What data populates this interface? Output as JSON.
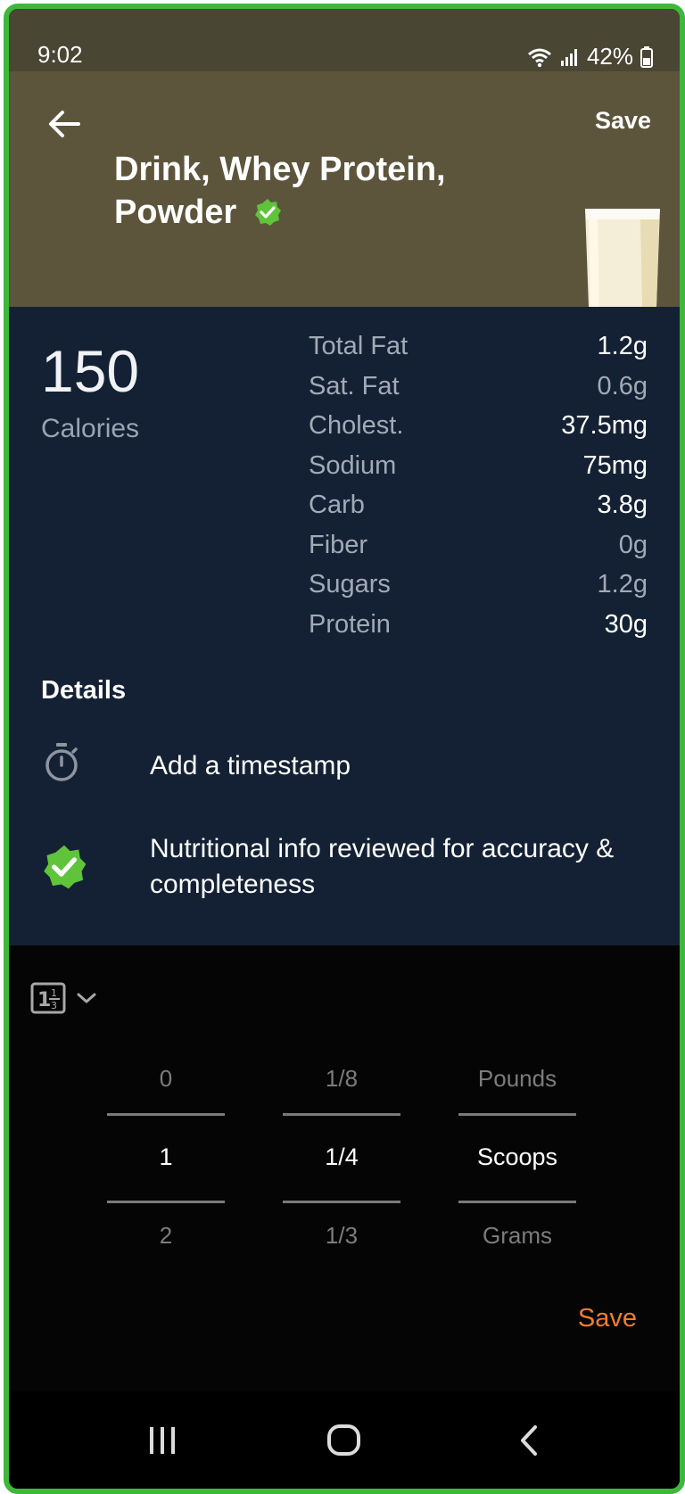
{
  "status_bar": {
    "time": "9:02",
    "battery": "42%",
    "wifi_icon": "wifi-icon",
    "signal_icon": "signal-icon",
    "battery_icon": "battery-icon"
  },
  "header": {
    "save_label": "Save",
    "title_line1": "Drink, Whey Protein,",
    "title_line2": "Powder",
    "back_icon": "back-arrow-icon",
    "verified_icon": "verified-badge-icon",
    "background_color": "#5c553c"
  },
  "summary": {
    "calories_value": "150",
    "calories_label": "Calories"
  },
  "nutrients": [
    {
      "name": "Total Fat",
      "value": "1.2g",
      "emphasis": "bright"
    },
    {
      "name": "Sat. Fat",
      "value": "0.6g",
      "emphasis": "dim"
    },
    {
      "name": "Cholest.",
      "value": "37.5mg",
      "emphasis": "bright"
    },
    {
      "name": "Sodium",
      "value": "75mg",
      "emphasis": "bright"
    },
    {
      "name": "Carb",
      "value": "3.8g",
      "emphasis": "bright"
    },
    {
      "name": "Fiber",
      "value": "0g",
      "emphasis": "dim"
    },
    {
      "name": "Sugars",
      "value": "1.2g",
      "emphasis": "dim"
    },
    {
      "name": "Protein",
      "value": "30g",
      "emphasis": "bright"
    }
  ],
  "details": {
    "title": "Details",
    "timestamp_label": "Add a timestamp",
    "reviewed_text": "Nutritional info reviewed for accuracy & completeness",
    "timer_icon": "stopwatch-icon",
    "reviewed_icon": "verified-badge-icon"
  },
  "picker": {
    "toggle_icon": "fraction-icon",
    "chevron_icon": "chevron-down-icon",
    "whole": {
      "above": "0",
      "selected": "1",
      "below": "2"
    },
    "fraction": {
      "above": "1/8",
      "selected": "1/4",
      "below": "1/3"
    },
    "unit": {
      "above": "Pounds",
      "selected": "Scoops",
      "below": "Grams"
    },
    "save_label": "Save",
    "accent_color": "#ef7d2f"
  },
  "navbar": {
    "recent_icon": "recent-apps-icon",
    "home_icon": "home-icon",
    "back_icon": "back-chevron-icon"
  }
}
